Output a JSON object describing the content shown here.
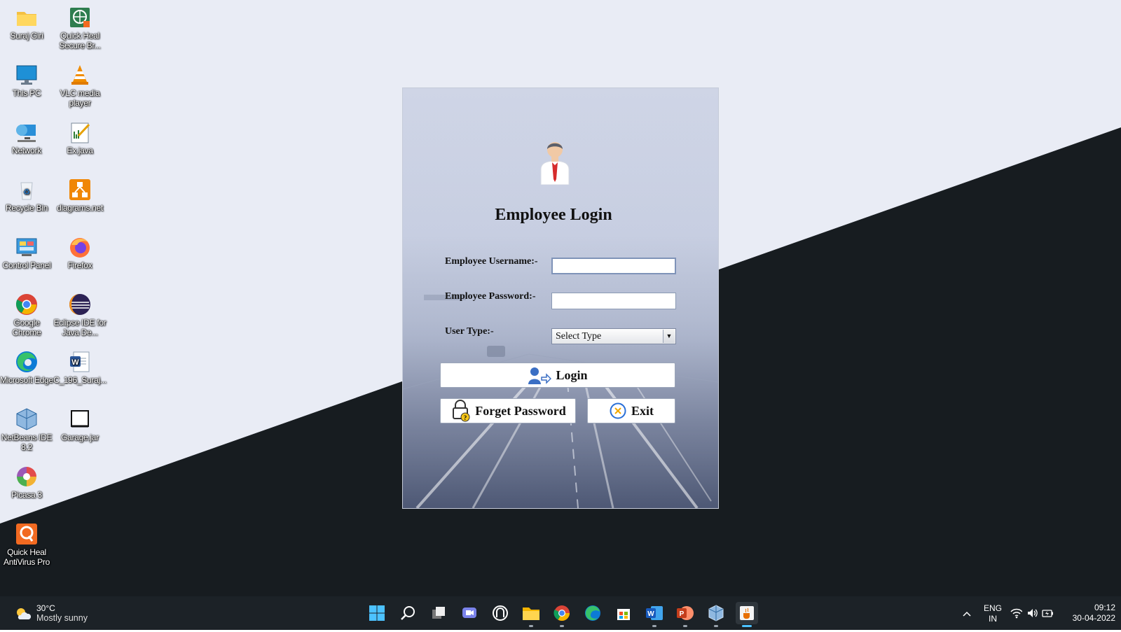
{
  "desktop": {
    "icons": [
      {
        "label": "Suraj Giri"
      },
      {
        "label": "Quick Heal Secure Br..."
      },
      {
        "label": "This PC"
      },
      {
        "label": "VLC media player"
      },
      {
        "label": "Network"
      },
      {
        "label": "Ex.java"
      },
      {
        "label": "Recycle Bin"
      },
      {
        "label": "diagrams.net"
      },
      {
        "label": "Control Panel"
      },
      {
        "label": "Firefox"
      },
      {
        "label": "Google Chrome"
      },
      {
        "label": "Eclipse IDE for Java De..."
      },
      {
        "label": "Microsoft Edge"
      },
      {
        "label": "C_196_Suraj..."
      },
      {
        "label": "NetBeans IDE 8.2"
      },
      {
        "label": "Garage.jar"
      },
      {
        "label": "Picasa 3"
      },
      {
        "label": "Quick Heal AntiVirus Pro"
      }
    ]
  },
  "login": {
    "title": "Employee Login",
    "username_label": "Employee Username:-",
    "username_value": "",
    "password_label": "Employee Password:-",
    "password_value": "",
    "usertype_label": "User Type:-",
    "usertype_selected": "Select Type",
    "login_button": "Login",
    "forget_button": "Forget Password",
    "exit_button": "Exit"
  },
  "taskbar": {
    "weather_temp": "30°C",
    "weather_desc": "Mostly sunny",
    "language_line1": "ENG",
    "language_line2": "IN",
    "time": "09:12",
    "date": "30-04-2022",
    "apps": [
      "start",
      "search",
      "task-view",
      "chat",
      "widgets",
      "file-explorer",
      "chrome",
      "edge",
      "store",
      "word",
      "powerpoint",
      "netbeans",
      "java"
    ]
  },
  "colors": {
    "desktop_light": "#e9ecf5",
    "desktop_dark": "#171c20",
    "taskbar": "#1c2227",
    "accent": "#4cc2ff"
  }
}
